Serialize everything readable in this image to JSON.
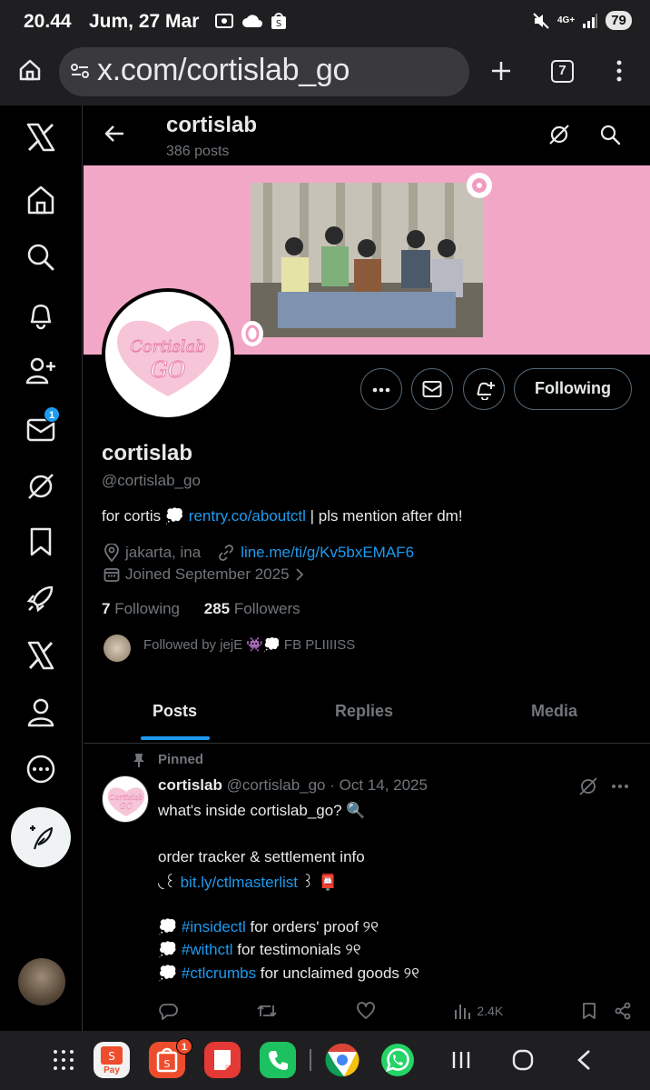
{
  "status": {
    "time": "20.44",
    "date": "Jum, 27 Mar",
    "network": "4G+",
    "battery": "79"
  },
  "browser": {
    "url": "x.com/cortislab_go",
    "tab_count": "7"
  },
  "sidebar": {
    "items": [
      {
        "name": "x-logo-icon"
      },
      {
        "name": "home-icon"
      },
      {
        "name": "search-icon"
      },
      {
        "name": "notifications-icon"
      },
      {
        "name": "follow-icon"
      },
      {
        "name": "messages-icon",
        "badge": "1"
      },
      {
        "name": "grok-icon"
      },
      {
        "name": "bookmark-icon"
      },
      {
        "name": "rocket-icon"
      },
      {
        "name": "premium-x-icon"
      },
      {
        "name": "profile-icon"
      },
      {
        "name": "more-icon"
      }
    ]
  },
  "header": {
    "name": "cortislab",
    "post_count": "386 posts"
  },
  "profile": {
    "avatar_text": "Cortislab GO",
    "name": "cortislab",
    "handle": "@cortislab_go",
    "bio_prefix": "for cortis 💭 ",
    "bio_link": "rentry.co/aboutctl",
    "bio_suffix": " | pls mention after dm!",
    "location": "jakarta, ina",
    "website": "line.me/ti/g/Kv5bxEMAF6",
    "joined": "Joined September 2025",
    "following_count": "7",
    "following_label": "Following",
    "followers_count": "285",
    "followers_label": "Followers",
    "followed_by": "Followed by jejE 👾💭 FB PLIIIISS",
    "follow_button": "Following"
  },
  "tabs": [
    "Posts",
    "Replies",
    "Media"
  ],
  "post": {
    "pinned_label": "Pinned",
    "author": "cortislab",
    "handle_date": "@cortislab_go · Oct 14, 2025",
    "line1": "what's inside cortislab_go? 🔍",
    "line2": "order tracker & settlement info",
    "line3_pre": "◟꒰ ",
    "line3_link": "bit.ly/ctlmasterlist",
    "line3_post": " ꒱ 📮",
    "tag1": "#insidectl",
    "tag1_text": " for orders' proof ୨୧",
    "tag2": "#withctl",
    "tag2_text": " for testimonials  ୨୧",
    "tag3": "#ctlcrumbs",
    "tag3_text": " for unclaimed goods ୨୧",
    "bullet": "💭 ",
    "views": "2.4K"
  },
  "apps": {
    "shopeepay_label": "Pay",
    "shopee_badge": "1"
  },
  "colors": {
    "accent": "#1d9bf0",
    "banner": "#f3a7c6",
    "background": "#000000"
  }
}
